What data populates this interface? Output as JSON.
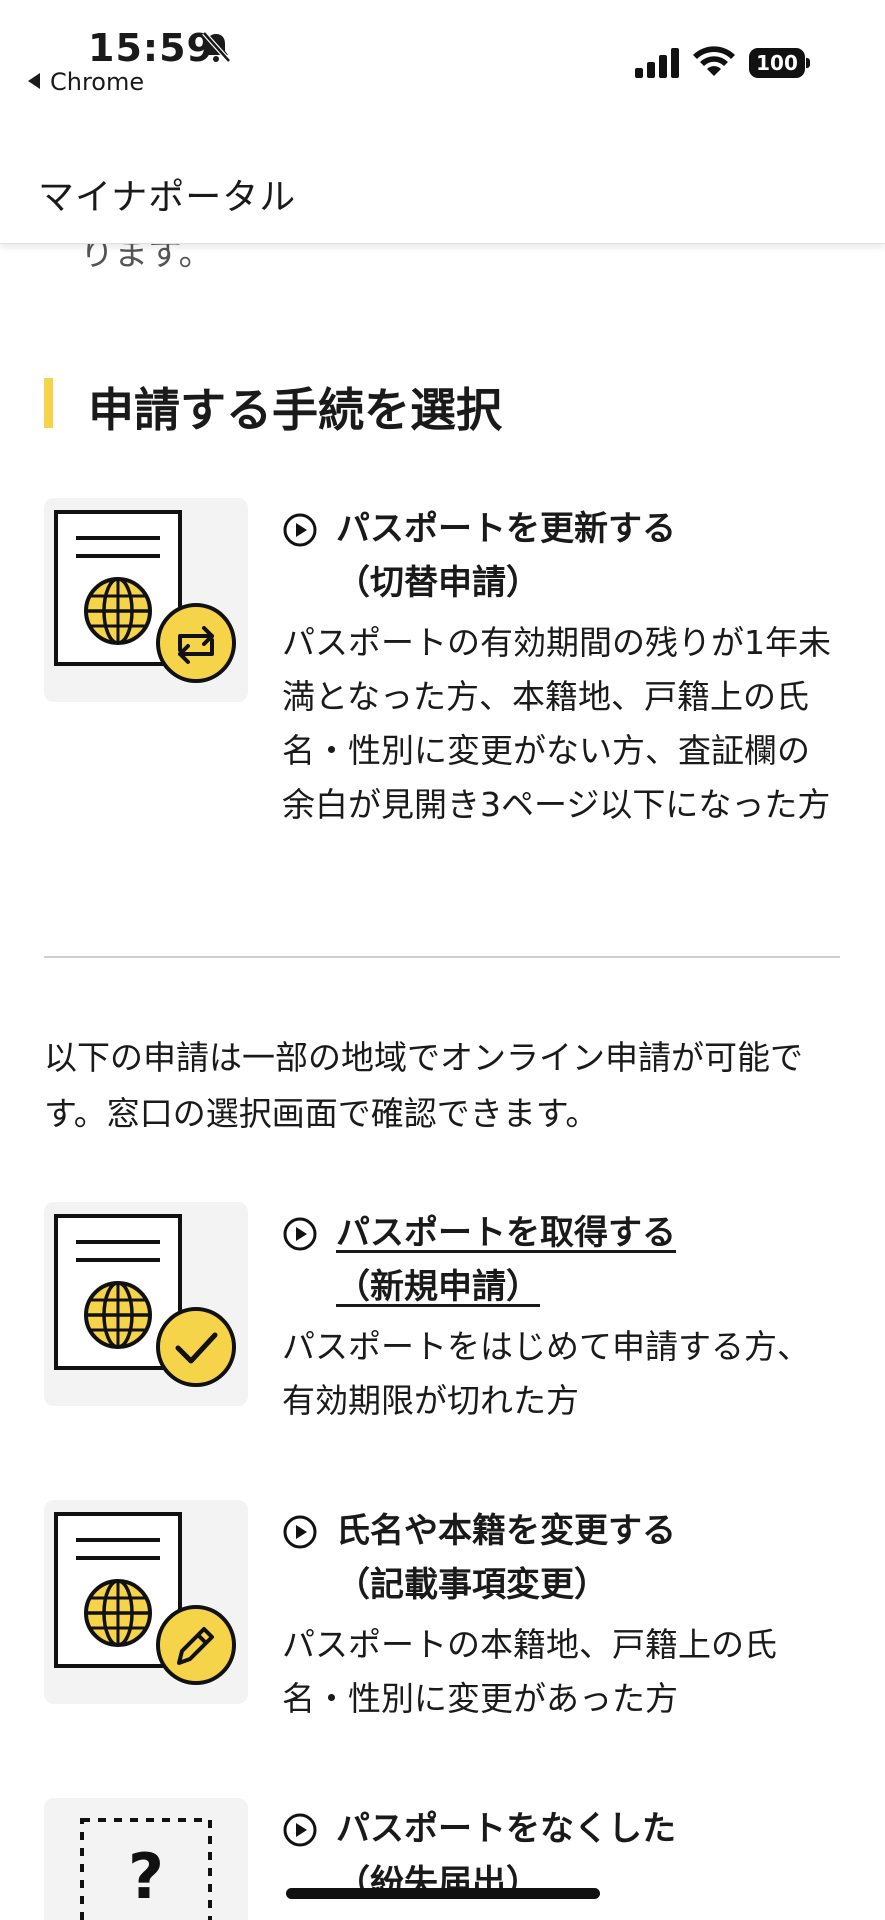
{
  "status_bar": {
    "time": "15:59",
    "back_app": "Chrome",
    "battery": "100"
  },
  "header": {
    "title": "マイナポータル"
  },
  "cutoff_text": "ります。",
  "section": {
    "heading": "申請する手続を選択"
  },
  "items": [
    {
      "title_line1": "パスポートを更新する",
      "title_line2": "（切替申請）",
      "description": "パスポートの有効期間の残りが1年未満となった方、本籍地、戸籍上の氏名・性別に変更がない方、査証欄の余白が見開き3ページ以下になった方",
      "badge_icon": "refresh-icon"
    },
    {
      "title_line1": "パスポートを取得する",
      "title_line2": "（新規申請）",
      "description": "パスポートをはじめて申請する方、有効期限が切れた方",
      "badge_icon": "check-icon"
    },
    {
      "title_line1": "氏名や本籍を変更する",
      "title_line2": "（記載事項変更）",
      "description": "パスポートの本籍地、戸籍上の氏名・性別に変更があった方",
      "badge_icon": "pencil-icon"
    },
    {
      "title_line1": "パスポートをなくした",
      "title_line2": "（紛失届出）",
      "description": "",
      "badge_icon": "question-icon"
    }
  ],
  "notice": "以下の申請は一部の地域でオンライン申請が可能です。窓口の選択画面で確認できます。",
  "colors": {
    "accent_yellow": "#f5d44a",
    "thumb_bg": "#f3f3f3",
    "text": "#1a1a1a",
    "divider": "#cfcfcf"
  }
}
